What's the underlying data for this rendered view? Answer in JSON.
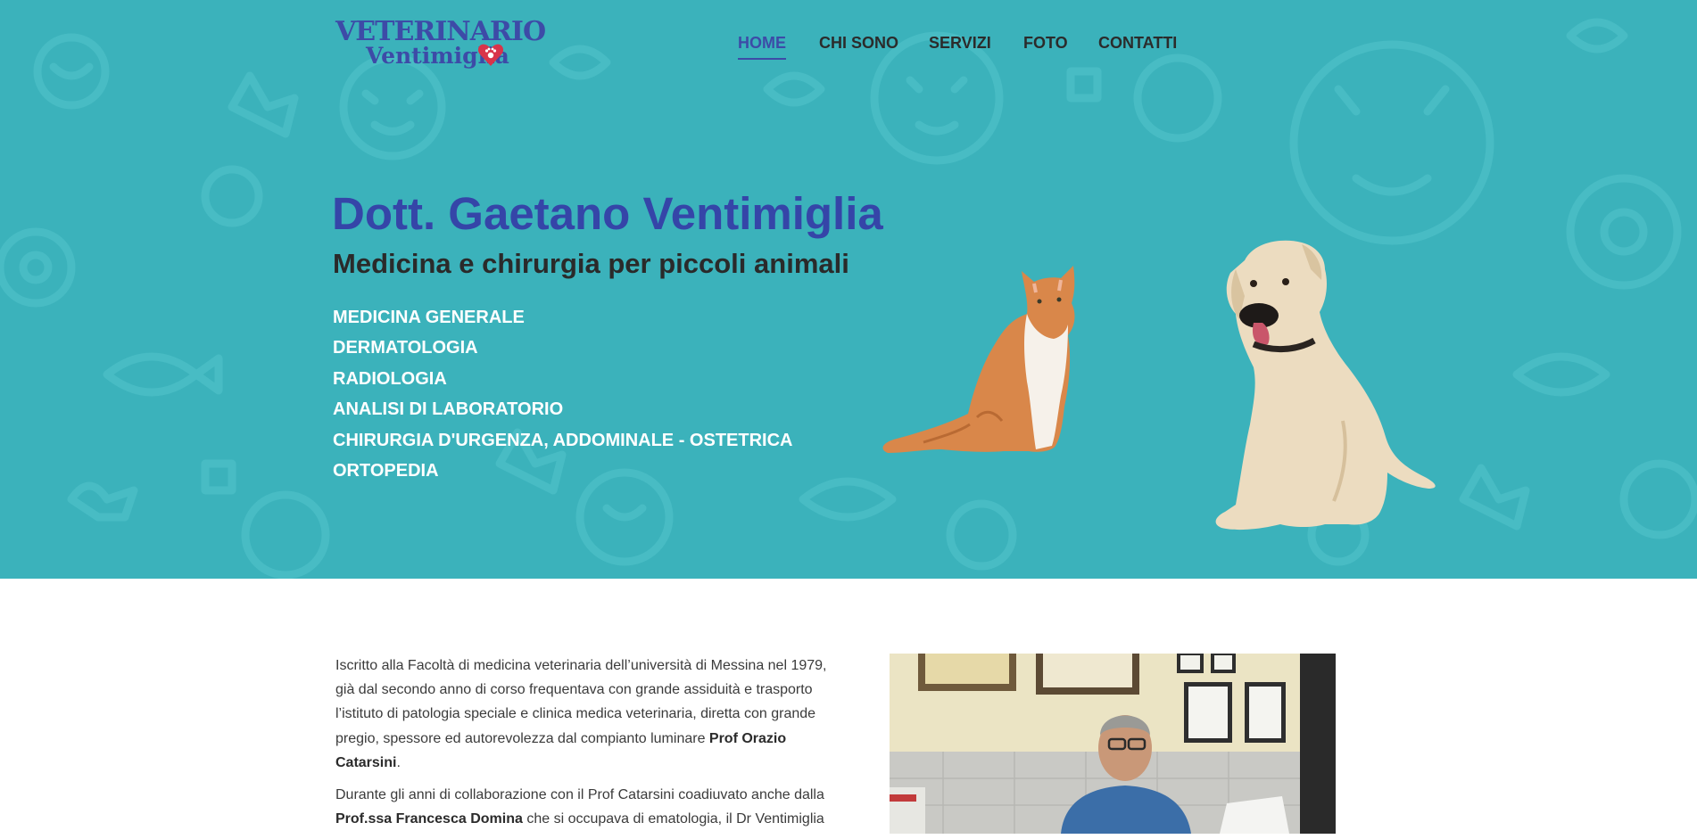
{
  "brand": {
    "logo_line1": "VETERINARIO",
    "logo_line2": "Ventimiglia",
    "logo_color": "#3d4ba7",
    "heart_color": "#d8344a"
  },
  "nav": {
    "items": [
      "HOME",
      "CHI SONO",
      "SERVIZI",
      "FOTO",
      "CONTATTI"
    ],
    "active": "HOME"
  },
  "hero": {
    "title": "Dott. Gaetano Ventimiglia",
    "subtitle": "Medicina e chirurgia per piccoli animali",
    "services": [
      "MEDICINA GENERALE",
      "DERMATOLOGIA",
      "RADIOLOGIA",
      "ANALISI DI LABORATORIO",
      "CHIRURGIA D'URGENZA, ADDOMINALE - OSTETRICA",
      "ORTOPEDIA"
    ],
    "background_color": "#3bb2bb",
    "title_color": "#3545a8"
  },
  "bio": {
    "p1_a": "Iscritto alla Facoltà di medicina veterinaria dell’università di Messina nel 1979, già dal secondo anno di corso frequentava con grande assiduità e trasporto l’istituto di patologia speciale e clinica medica veterinaria, diretta con grande pregio, spessore ed autorevolezza dal compianto luminare ",
    "p1_b": "Prof Orazio Catarsini",
    "p1_c": ".",
    "p2_a": "Durante gli anni di collaborazione con il Prof Catarsini coadiuvato anche dalla ",
    "p2_b": "Prof.ssa Francesca Domina",
    "p2_c": " che si occupava di ematologia, il Dr Ventimiglia"
  }
}
